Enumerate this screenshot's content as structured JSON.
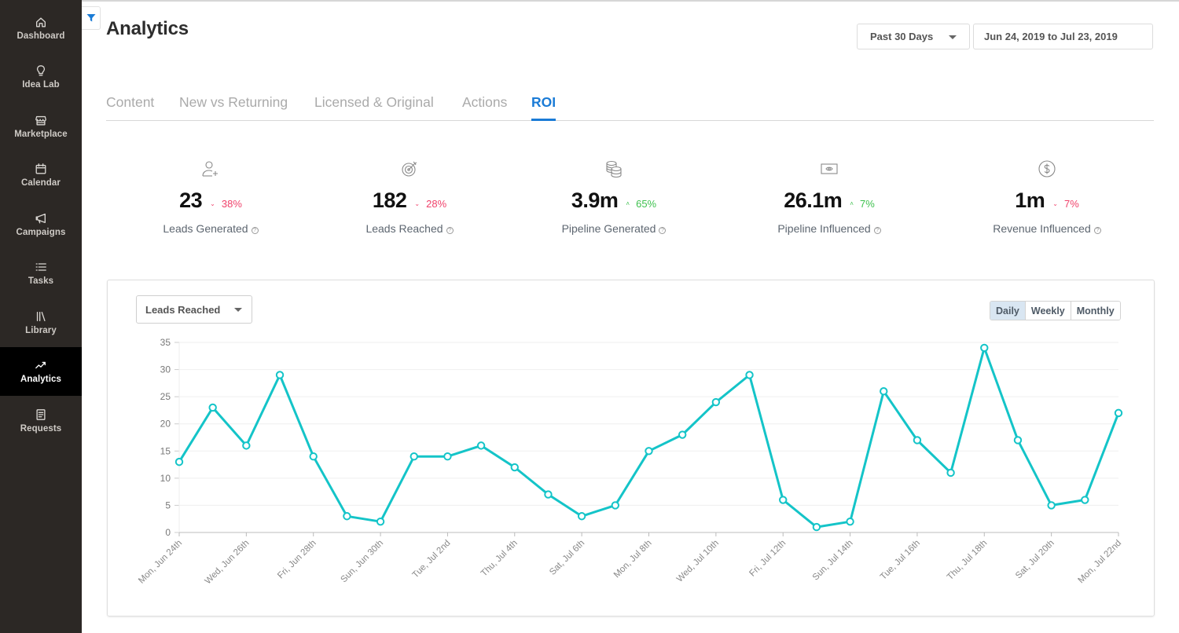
{
  "sidebar": {
    "items": [
      {
        "label": "Dashboard",
        "icon": "home-icon"
      },
      {
        "label": "Idea Lab",
        "icon": "lightbulb-icon"
      },
      {
        "label": "Marketplace",
        "icon": "store-icon"
      },
      {
        "label": "Calendar",
        "icon": "calendar-icon"
      },
      {
        "label": "Campaigns",
        "icon": "megaphone-icon"
      },
      {
        "label": "Tasks",
        "icon": "list-icon"
      },
      {
        "label": "Library",
        "icon": "library-icon"
      },
      {
        "label": "Analytics",
        "icon": "trend-up-icon",
        "active": true
      },
      {
        "label": "Requests",
        "icon": "document-icon"
      }
    ]
  },
  "header": {
    "title": "Analytics",
    "filter_icon": "filter-icon",
    "range_select": "Past 30 Days",
    "date_range": "Jun 24, 2019 to Jul 23, 2019"
  },
  "tabs": [
    {
      "label": "Content"
    },
    {
      "label": "New vs Returning"
    },
    {
      "label": "Licensed & Original"
    },
    {
      "label": "Actions"
    },
    {
      "label": "ROI",
      "active": true
    }
  ],
  "kpis": [
    {
      "value": "23",
      "change": "38%",
      "direction": "down",
      "label": "Leads Generated",
      "icon": "user-plus-icon"
    },
    {
      "value": "182",
      "change": "28%",
      "direction": "down",
      "label": "Leads Reached",
      "icon": "target-icon"
    },
    {
      "value": "3.9m",
      "change": "65%",
      "direction": "up",
      "label": "Pipeline Generated",
      "icon": "coins-icon"
    },
    {
      "value": "26.1m",
      "change": "7%",
      "direction": "up",
      "label": "Pipeline Influenced",
      "icon": "banknote-icon"
    },
    {
      "value": "1m",
      "change": "7%",
      "direction": "down",
      "label": "Revenue Influenced",
      "icon": "dollar-circle-icon"
    }
  ],
  "chart_controls": {
    "metric": "Leads Reached",
    "periods": [
      {
        "label": "Daily",
        "active": true
      },
      {
        "label": "Weekly"
      },
      {
        "label": "Monthly"
      }
    ]
  },
  "colors": {
    "accent": "#1a7bd6",
    "line": "#14c4c8",
    "down": "#f0426b",
    "up": "#3fc14f"
  },
  "chart_data": {
    "type": "line",
    "title": "",
    "xlabel": "",
    "ylabel": "",
    "ylim": [
      0,
      35
    ],
    "yticks": [
      0,
      5,
      10,
      15,
      20,
      25,
      30,
      35
    ],
    "grid": true,
    "legend": "none",
    "x": [
      "Mon, Jun 24th",
      "Tue, Jun 25th",
      "Wed, Jun 26th",
      "Thu, Jun 27th",
      "Fri, Jun 28th",
      "Sat, Jun 29th",
      "Sun, Jun 30th",
      "Mon, Jul 1st",
      "Tue, Jul 2nd",
      "Wed, Jul 3rd",
      "Thu, Jul 4th",
      "Fri, Jul 5th",
      "Sat, Jul 6th",
      "Sun, Jul 7th",
      "Mon, Jul 8th",
      "Tue, Jul 9th",
      "Wed, Jul 10th",
      "Thu, Jul 11th",
      "Fri, Jul 12th",
      "Sat, Jul 13th",
      "Sun, Jul 14th",
      "Mon, Jul 15th",
      "Tue, Jul 16th",
      "Wed, Jul 17th",
      "Thu, Jul 18th",
      "Fri, Jul 19th",
      "Sat, Jul 20th",
      "Sun, Jul 21st",
      "Mon, Jul 22nd"
    ],
    "tick_labels_shown": [
      "Mon, Jun 24th",
      "Wed, Jun 26th",
      "Fri, Jun 28th",
      "Sun, Jun 30th",
      "Tue, Jul 2nd",
      "Thu, Jul 4th",
      "Sat, Jul 6th",
      "Mon, Jul 8th",
      "Wed, Jul 10th",
      "Fri, Jul 12th",
      "Sun, Jul 14th",
      "Tue, Jul 16th",
      "Thu, Jul 18th",
      "Sat, Jul 20th",
      "Mon, Jul 22nd"
    ],
    "series": [
      {
        "name": "Leads Reached",
        "values": [
          13,
          23,
          16,
          29,
          14,
          3,
          2,
          14,
          14,
          16,
          12,
          7,
          3,
          5,
          15,
          18,
          24,
          29,
          6,
          1,
          2,
          26,
          17,
          11,
          34,
          17,
          5,
          6,
          22
        ]
      }
    ]
  }
}
